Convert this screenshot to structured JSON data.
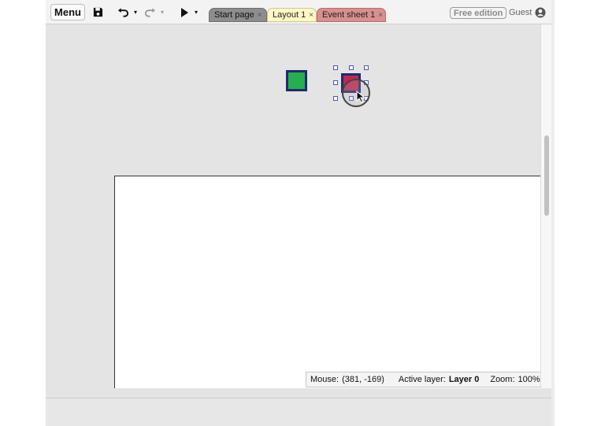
{
  "toolbar": {
    "menu_label": "Menu",
    "save_icon": "save-icon",
    "undo_icon": "undo-icon",
    "redo_icon": "redo-icon",
    "play_icon": "play-icon",
    "dropdown_glyph": "▾"
  },
  "tabs": [
    {
      "label": "Start page",
      "close": "×"
    },
    {
      "label": "Layout 1",
      "close": "×"
    },
    {
      "label": "Event sheet 1",
      "close": "×"
    }
  ],
  "account": {
    "edition_label": "Free edition",
    "user_label": "Guest",
    "user_icon": "user-circle-icon"
  },
  "status": {
    "mouse_label": "Mouse:",
    "mouse_value": "(381, -169)",
    "layer_label": "Active layer:",
    "layer_value": "Layer 0",
    "zoom_label": "Zoom:",
    "zoom_value": "100%"
  },
  "colors": {
    "green_sprite": "#24b04e",
    "red_sprite": "#c0274f",
    "sprite_border": "#1f2a6e",
    "active_tab": "#fff7c6",
    "event_tab": "#d98f8f"
  }
}
